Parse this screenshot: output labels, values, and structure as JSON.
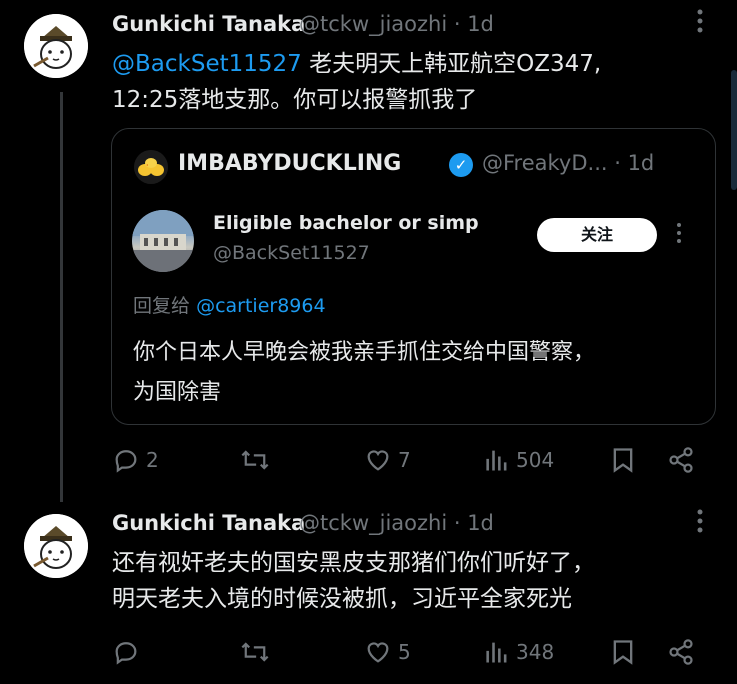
{
  "tweets": [
    {
      "author_name": "Gunkichi Tanaka",
      "author_handle": "@tckw_jiaozhi · 1d",
      "text_mention": "@BackSet11527",
      "text_line1": " 老夫明天上韩亚航空OZ347,",
      "text_line2": "12:25落地支那。你可以报警抓我了",
      "quote": {
        "author_name": "IMBABYDUCKLING",
        "author_handle": "@FreakyD... · 1d",
        "inner_name": "Eligible bachelor or simp",
        "inner_handle": "@BackSet11527",
        "follow_label": "关注",
        "reply_prefix": "回复给",
        "reply_mention": "@cartier8964",
        "text_line1": "你个日本人早晚会被我亲手抓住交给中国警察，",
        "text_line2": "为国除害"
      },
      "stats": {
        "replies": "2",
        "retweets": "",
        "likes": "7",
        "views": "504"
      }
    },
    {
      "author_name": "Gunkichi Tanaka",
      "author_handle": "@tckw_jiaozhi · 1d",
      "text_line1": "还有视奸老夫的国安黑皮支那猪们你们听好了，",
      "text_line2": "明天老夫入境的时候没被抓，习近平全家死光",
      "stats": {
        "replies": "",
        "retweets": "",
        "likes": "5",
        "views": "348"
      }
    }
  ],
  "icons": {
    "reply": "reply-icon",
    "retweet": "retweet-icon",
    "like": "heart-icon",
    "views": "views-icon",
    "bookmark": "bookmark-icon",
    "share": "share-icon",
    "more": "more-icon",
    "verified": "verified-badge-icon"
  },
  "colors": {
    "background": "#000000",
    "accent": "#1d9bf0",
    "muted": "#71767b",
    "text": "#e7e9ea"
  }
}
